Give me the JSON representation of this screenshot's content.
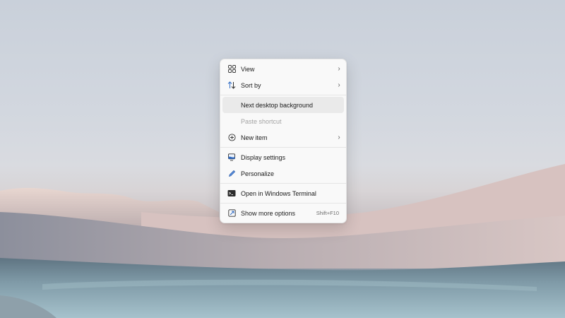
{
  "desktop": {
    "accent": "#3a7bd5"
  },
  "context_menu": {
    "view": {
      "label": "View",
      "icon": "view-grid-icon",
      "has_submenu": true
    },
    "sort_by": {
      "label": "Sort by",
      "icon": "sort-arrows-icon",
      "has_submenu": true
    },
    "next_background": {
      "label": "Next desktop background",
      "state": "hovered"
    },
    "paste_shortcut": {
      "label": "Paste shortcut",
      "state": "disabled"
    },
    "new_item": {
      "label": "New item",
      "icon": "plus-circle-icon",
      "has_submenu": true
    },
    "display_settings": {
      "label": "Display settings",
      "icon": "display-icon"
    },
    "personalize": {
      "label": "Personalize",
      "icon": "pen-icon"
    },
    "terminal": {
      "label": "Open in Windows Terminal",
      "icon": "terminal-icon"
    },
    "more_options": {
      "label": "Show more options",
      "icon": "more-options-icon",
      "shortcut": "Shift+F10"
    }
  }
}
